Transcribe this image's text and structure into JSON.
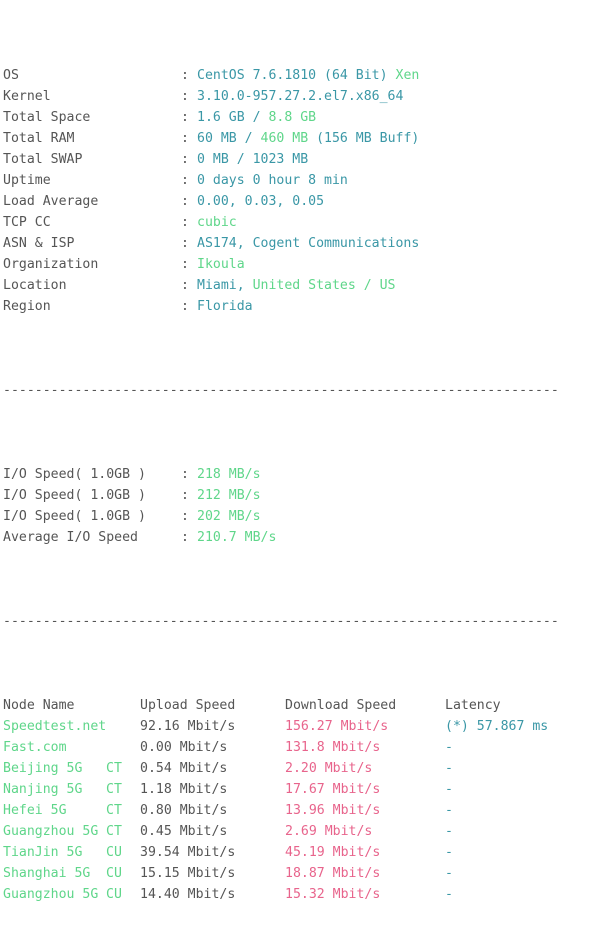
{
  "terminal": {
    "separator": "----------------------------------------------------------------------",
    "sysinfo": [
      {
        "key": "OS",
        "colon": ":",
        "parts": [
          {
            "t": "CentOS 7.6.1810 (64 Bit) ",
            "c": "teal"
          },
          {
            "t": "Xen",
            "c": "green"
          }
        ]
      },
      {
        "key": "Kernel",
        "colon": ":",
        "parts": [
          {
            "t": "3.10.0-957.27.2.el7.x86_64",
            "c": "teal"
          }
        ]
      },
      {
        "key": "Total Space",
        "colon": ":",
        "parts": [
          {
            "t": "1.6 GB ",
            "c": "teal"
          },
          {
            "t": "/ ",
            "c": "teal"
          },
          {
            "t": "8.8 GB",
            "c": "green"
          }
        ]
      },
      {
        "key": "Total RAM",
        "colon": ":",
        "parts": [
          {
            "t": "60 MB ",
            "c": "teal"
          },
          {
            "t": "/ ",
            "c": "teal"
          },
          {
            "t": "460 MB",
            "c": "green"
          },
          {
            "t": " (156 MB Buff)",
            "c": "teal"
          }
        ]
      },
      {
        "key": "Total SWAP",
        "colon": ":",
        "parts": [
          {
            "t": "0 MB / 1023 MB",
            "c": "teal"
          }
        ]
      },
      {
        "key": "Uptime",
        "colon": ":",
        "parts": [
          {
            "t": "0 days 0 hour 8 min",
            "c": "teal"
          }
        ]
      },
      {
        "key": "Load Average",
        "colon": ":",
        "parts": [
          {
            "t": "0.00, 0.03, 0.05",
            "c": "teal"
          }
        ]
      },
      {
        "key": "TCP CC",
        "colon": ":",
        "parts": [
          {
            "t": "cubic",
            "c": "green"
          }
        ]
      },
      {
        "key": "ASN & ISP",
        "colon": ":",
        "parts": [
          {
            "t": "AS174, Cogent Communications",
            "c": "teal"
          }
        ]
      },
      {
        "key": "Organization",
        "colon": ":",
        "parts": [
          {
            "t": "Ikoula",
            "c": "green"
          }
        ]
      },
      {
        "key": "Location",
        "colon": ":",
        "parts": [
          {
            "t": "Miami, ",
            "c": "teal"
          },
          {
            "t": "United States / US",
            "c": "green"
          }
        ]
      },
      {
        "key": "Region",
        "colon": ":",
        "parts": [
          {
            "t": "Florida",
            "c": "teal"
          }
        ]
      }
    ],
    "iospeed": [
      {
        "key": "I/O Speed( 1.0GB )",
        "colon": ":",
        "value": "218 MB/s",
        "c": "green"
      },
      {
        "key": "I/O Speed( 1.0GB )",
        "colon": ":",
        "value": "212 MB/s",
        "c": "green"
      },
      {
        "key": "I/O Speed( 1.0GB )",
        "colon": ":",
        "value": "202 MB/s",
        "c": "green"
      },
      {
        "key": "Average I/O Speed",
        "colon": ":",
        "value": "210.7 MB/s",
        "c": "green"
      }
    ],
    "speedtest": {
      "headers": [
        "Node Name",
        "Upload Speed",
        "Download Speed",
        "Latency"
      ],
      "rows": [
        {
          "node": "Speedtest.net",
          "isp": "",
          "upload": "92.16 Mbit/s",
          "download": "156.27 Mbit/s",
          "latency": "(*) 57.867 ms"
        },
        {
          "node": "Fast.com",
          "isp": "",
          "upload": "0.00 Mbit/s",
          "download": "131.8 Mbit/s",
          "latency": "-"
        },
        {
          "node": "Beijing 5G",
          "isp": "CT",
          "upload": "0.54 Mbit/s",
          "download": "2.20 Mbit/s",
          "latency": "-"
        },
        {
          "node": "Nanjing 5G",
          "isp": "CT",
          "upload": "1.18 Mbit/s",
          "download": "17.67 Mbit/s",
          "latency": "-"
        },
        {
          "node": "Hefei 5G",
          "isp": "CT",
          "upload": "0.80 Mbit/s",
          "download": "13.96 Mbit/s",
          "latency": "-"
        },
        {
          "node": "Guangzhou 5G",
          "isp": "CT",
          "upload": "0.45 Mbit/s",
          "download": "2.69 Mbit/s",
          "latency": "-"
        },
        {
          "node": "TianJin 5G",
          "isp": "CU",
          "upload": "39.54 Mbit/s",
          "download": "45.19 Mbit/s",
          "latency": "-"
        },
        {
          "node": "Shanghai 5G",
          "isp": "CU",
          "upload": "15.15 Mbit/s",
          "download": "18.87 Mbit/s",
          "latency": "-"
        },
        {
          "node": "Guangzhou 5G",
          "isp": "CU",
          "upload": "14.40 Mbit/s",
          "download": "15.32 Mbit/s",
          "latency": "-"
        }
      ]
    },
    "colors": {
      "label": "#555555",
      "teal": "#3a97a6",
      "green": "#5fd68a",
      "pink": "#e8648c",
      "plain": "#555555",
      "background": "#ffffff"
    }
  }
}
